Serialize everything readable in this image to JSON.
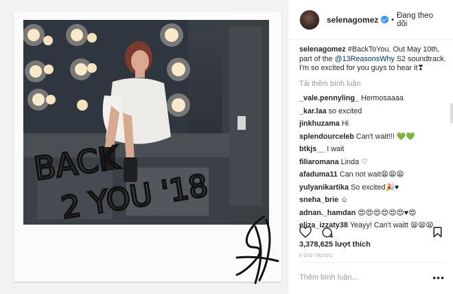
{
  "post": {
    "username": "selenagomez",
    "follow_status": "Đang theo dõi",
    "caption_user": "selenagomez",
    "caption_text_1": " #BackToYou. Out May 10th, part of the ",
    "caption_mention": "@13ReasonsWhy",
    "caption_text_2": " S2 soundtrack. I'm so excited for you guys to hear it❣",
    "load_more": "Tải thêm bình luận",
    "comments": [
      {
        "user": "_vale.pennyling_",
        "text": "Hermosaaaa"
      },
      {
        "user": "_kar.laa",
        "text": "so excited"
      },
      {
        "user": "jinkhuzama",
        "text": "Hi"
      },
      {
        "user": "splendourceleb",
        "text": "Can't wait!!! 💚💚"
      },
      {
        "user": "btkjs__",
        "text": "I wait"
      },
      {
        "user": "filiaromana",
        "text": "Linda ♡"
      },
      {
        "user": "afaduma11",
        "text": "Can not wait😩😩😩"
      },
      {
        "user": "yulyanikartika",
        "text": "So excited🎉♥"
      },
      {
        "user": "sneha_brie",
        "text": "☺"
      },
      {
        "user": "adnan._hamdan",
        "text": "😍😍😍😍😍😍♥😍"
      },
      {
        "user": "eliza_izzaty38",
        "text": "Yeayy! Can't waitt 😩😩😩"
      }
    ],
    "likes": "3,378,625 lượt thích",
    "time": "9 GIỜ TRƯỚC",
    "add_comment_placeholder": "Thêm bình luận...",
    "more": "•••"
  },
  "photo": {
    "handwriting_line1": "BACK",
    "handwriting_line2": "2 YOU '18"
  },
  "icons": {
    "like": "heart-icon",
    "comment": "comment-icon",
    "save": "bookmark-icon",
    "verified": "verified-badge-icon"
  },
  "colors": {
    "verified": "#3897f0",
    "mention": "#003569",
    "muted": "#999999"
  }
}
